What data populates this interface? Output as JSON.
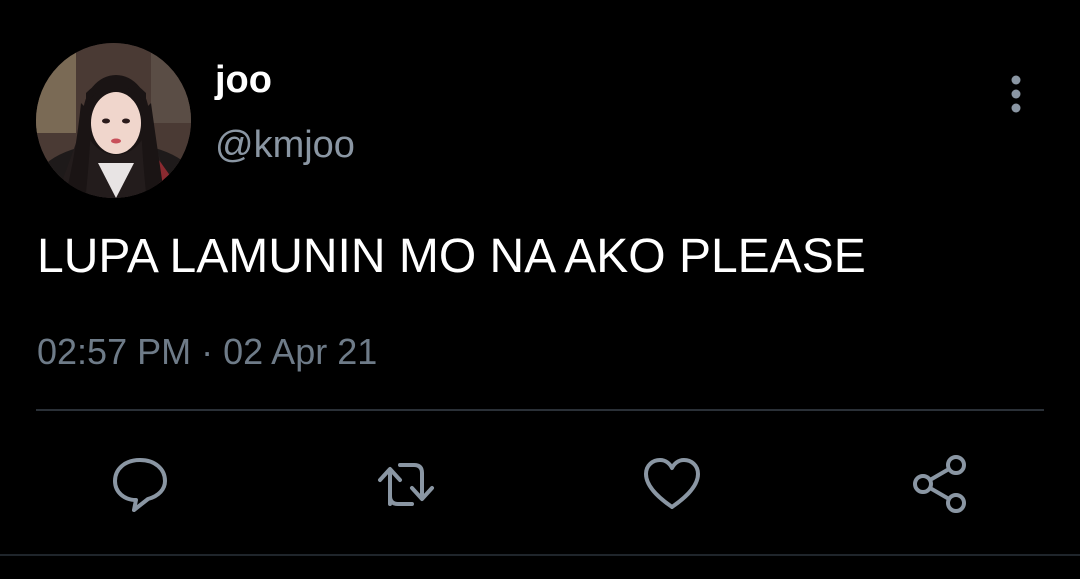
{
  "user": {
    "display_name": "joo",
    "handle": "@kmjoo"
  },
  "tweet": {
    "text": "LUPA LAMUNIN MO NA AKO PLEASE",
    "time": "02:57 PM",
    "separator": "·",
    "date": "02 Apr 21"
  },
  "actions": {
    "reply_icon": "speech-bubble",
    "retweet_icon": "retweet-arrows",
    "like_icon": "heart",
    "share_icon": "share-nodes",
    "more_icon": "vertical-ellipsis"
  },
  "colors": {
    "background": "#000000",
    "text_primary": "#ffffff",
    "text_secondary": "#8a96a3",
    "icon": "#8a96a3",
    "divider": "#2a3037"
  }
}
